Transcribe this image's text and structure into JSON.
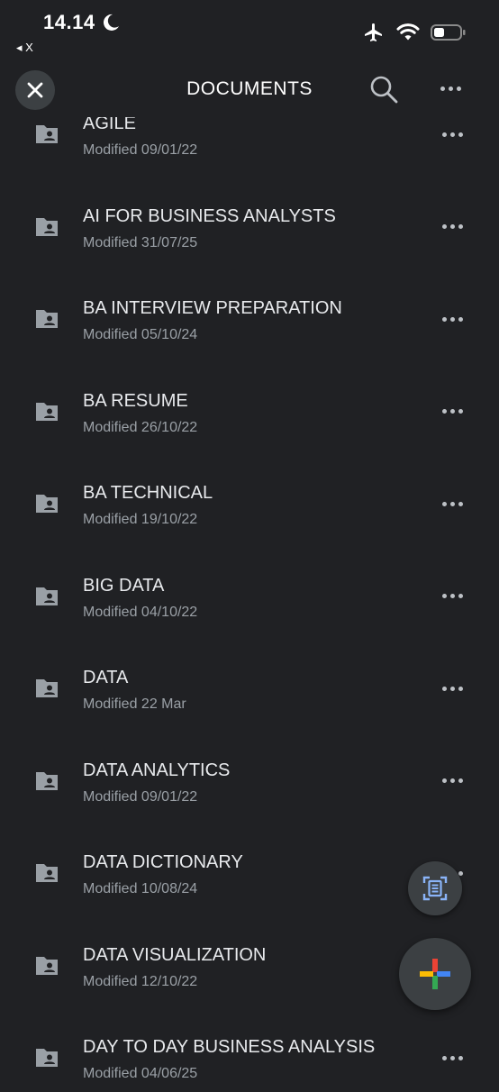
{
  "status_bar": {
    "time": "14.14",
    "back_app": "◂ X"
  },
  "header": {
    "title": "DOCUMENTS"
  },
  "items": [
    {
      "title": "AGILE",
      "subtitle": "Modified 09/01/22"
    },
    {
      "title": "AI FOR BUSINESS ANALYSTS",
      "subtitle": "Modified 31/07/25"
    },
    {
      "title": "BA INTERVIEW PREPARATION",
      "subtitle": "Modified 05/10/24"
    },
    {
      "title": "BA RESUME",
      "subtitle": "Modified 26/10/22"
    },
    {
      "title": "BA TECHNICAL",
      "subtitle": "Modified 19/10/22"
    },
    {
      "title": "BIG DATA",
      "subtitle": "Modified 04/10/22"
    },
    {
      "title": "DATA",
      "subtitle": "Modified 22 Mar"
    },
    {
      "title": "DATA ANALYTICS",
      "subtitle": "Modified 09/01/22"
    },
    {
      "title": "DATA DICTIONARY",
      "subtitle": "Modified 10/08/24"
    },
    {
      "title": "DATA VISUALIZATION",
      "subtitle": "Modified 12/10/22"
    },
    {
      "title": "DAY TO DAY BUSINESS ANALYSIS",
      "subtitle": "Modified 04/06/25"
    }
  ],
  "icons": {
    "folder": "shared-folder-icon",
    "scan": "document-scan-icon",
    "add": "add-icon"
  },
  "colors": {
    "background": "#202124",
    "fab": "#3c4043",
    "text_primary": "#e8eaed",
    "text_secondary": "#9aa0a6",
    "google_blue": "#4285f4",
    "google_red": "#ea4335",
    "google_yellow": "#fbbc04",
    "google_green": "#34a853"
  }
}
